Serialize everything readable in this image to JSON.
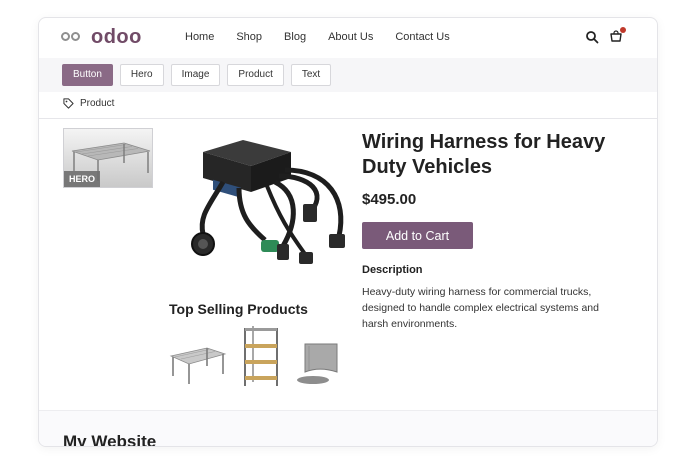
{
  "header": {
    "logo_text": "odoo",
    "nav": [
      "Home",
      "Shop",
      "Blog",
      "About Us",
      "Contact Us"
    ]
  },
  "toolbar": {
    "buttons": [
      "Button",
      "Hero",
      "Image",
      "Product",
      "Text"
    ],
    "active": "Button"
  },
  "breadcrumb": {
    "label": "Product"
  },
  "hero_thumbnail": {
    "badge": "HERO"
  },
  "product": {
    "title": "Wiring Harness for Heavy Duty Vehicles",
    "price": "$495.00",
    "add_to_cart": "Add to Cart",
    "description_title": "Description",
    "description": "Heavy-duty wiring harness for commercial trucks, designed to handle complex electrical systems and harsh environments."
  },
  "top_selling": {
    "title": "Top Selling Products"
  },
  "footer": {
    "site_title": "My Website"
  },
  "colors": {
    "brand": "#714b67",
    "accent_button": "#7a5a79",
    "cart_badge": "#c0392b"
  },
  "icons": [
    "search-icon",
    "cart-icon",
    "product-tag-icon"
  ]
}
